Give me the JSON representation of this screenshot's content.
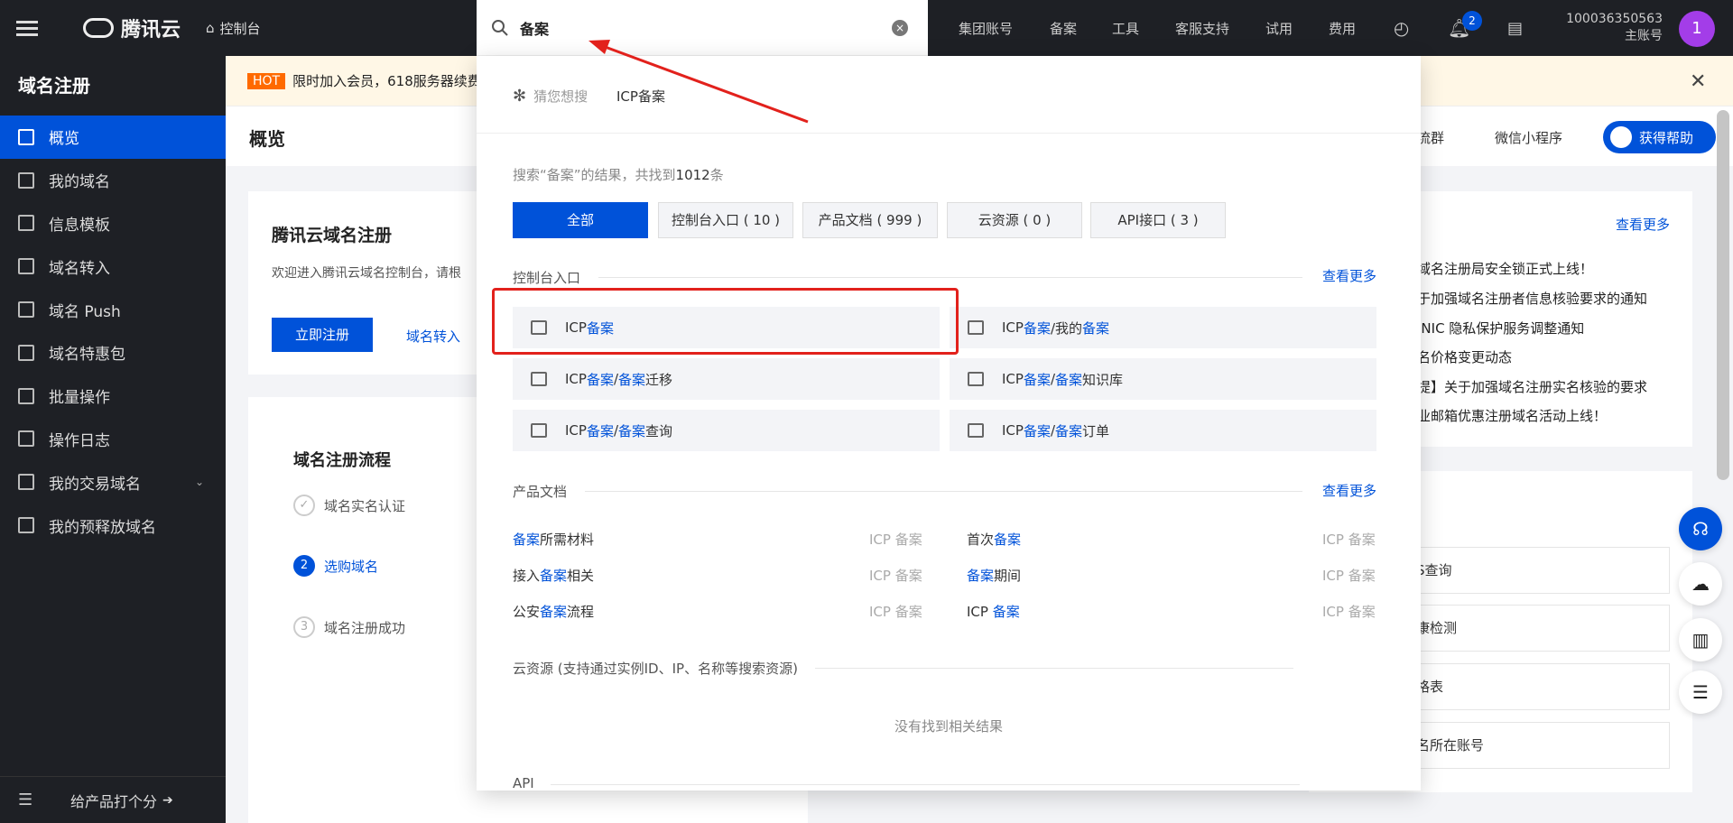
{
  "topbar": {
    "brand": "腾讯云",
    "console": "控制台",
    "search_value": "备案",
    "nav": [
      "集团账号",
      "备案",
      "工具",
      "客服支持",
      "试用",
      "费用"
    ],
    "notification_count": "2",
    "account_id": "100036350563",
    "account_role": "主账号",
    "avatar_letter": "1"
  },
  "sidebar": {
    "title": "域名注册",
    "items": [
      {
        "label": "概览",
        "icon": "grid-icon",
        "active": true
      },
      {
        "label": "我的域名",
        "icon": "domain-icon"
      },
      {
        "label": "信息模板",
        "icon": "template-icon"
      },
      {
        "label": "域名转入",
        "icon": "transfer-icon"
      },
      {
        "label": "域名 Push",
        "icon": "push-icon"
      },
      {
        "label": "域名特惠包",
        "icon": "package-icon"
      },
      {
        "label": "批量操作",
        "icon": "batch-icon"
      },
      {
        "label": "操作日志",
        "icon": "log-icon"
      },
      {
        "label": "我的交易域名",
        "icon": "trade-icon",
        "expandable": true
      },
      {
        "label": "我的预释放域名",
        "icon": "release-icon"
      }
    ],
    "footer": "给产品打个分"
  },
  "banner": {
    "tag": "HOT",
    "text": "限时加入会员，618服务器续费2"
  },
  "page": {
    "title": "概览",
    "links": [
      "流群",
      "微信小程序"
    ],
    "help_button": "获得帮助"
  },
  "welcome_card": {
    "title": "腾讯云域名注册",
    "desc": "欢迎进入腾讯云域名控制台，请根",
    "register_button": "立即注册",
    "transfer_link": "域名转入"
  },
  "flow_card": {
    "title": "域名注册流程",
    "steps": [
      {
        "num": "✓",
        "label": "域名实名认证"
      },
      {
        "num": "2",
        "label": "选购域名",
        "current": true
      },
      {
        "num": "3",
        "label": "域名注册成功"
      }
    ]
  },
  "news": {
    "more": "查看更多",
    "items": [
      "域名注册局安全锁正式上线！",
      "于加强域名注册者信息核验要求的通知",
      "INIC 隐私保护服务调整通知",
      "名价格变更动态",
      "提】关于加强域名注册实名核验的要求",
      "业邮箱优惠注册域名活动上线！"
    ]
  },
  "tools": [
    "S查询",
    "康检测",
    "格表",
    "名所在账号"
  ],
  "dropdown": {
    "guess_label": "猜您想搜",
    "guess_query": "ICP备案",
    "summary_prefix": "搜索“备案”的结果，共找到",
    "summary_count": "1012",
    "summary_suffix": "条",
    "filters": [
      {
        "label": "全部",
        "active": true
      },
      {
        "label": "控制台入口 ( 10 )"
      },
      {
        "label": "产品文档 ( 999 )"
      },
      {
        "label": "云资源 ( 0 )"
      },
      {
        "label": "API接口 ( 3 )"
      }
    ],
    "console_section": "控制台入口",
    "console_more": "查看更多",
    "console_entries": [
      {
        "pre": "ICP",
        "hl": "备案",
        "post": "",
        "icon": "icp-icon"
      },
      {
        "pre": "ICP",
        "hl": "备案",
        "post": "/我的",
        "hl2": "备案",
        "icon": "bookmark-icon"
      },
      {
        "pre": "ICP",
        "hl": "备案",
        "post": "/",
        "hl2": "备案",
        "post2": "迁移",
        "icon": "migrate-icon"
      },
      {
        "pre": "ICP",
        "hl": "备案",
        "post": "/",
        "hl2": "备案",
        "post2": "知识库",
        "icon": "knowledge-icon"
      },
      {
        "pre": "ICP",
        "hl": "备案",
        "post": "/",
        "hl2": "备案",
        "post2": "查询",
        "icon": "query-icon"
      },
      {
        "pre": "ICP",
        "hl": "备案",
        "post": "/",
        "hl2": "备案",
        "post2": "订单",
        "icon": "order-icon"
      }
    ],
    "docs_section": "产品文档",
    "docs_more": "查看更多",
    "docs": [
      {
        "pre": "",
        "hl": "备案",
        "post": "所需材料",
        "tag": "ICP 备案"
      },
      {
        "pre": "首次",
        "hl": "备案",
        "post": "",
        "tag": "ICP 备案"
      },
      {
        "pre": "接入",
        "hl": "备案",
        "post": "相关",
        "tag": "ICP 备案"
      },
      {
        "pre": "",
        "hl": "备案",
        "post": "期间",
        "tag": "ICP 备案"
      },
      {
        "pre": "公安",
        "hl": "备案",
        "post": "流程",
        "tag": "ICP 备案"
      },
      {
        "pre": "ICP ",
        "hl": "备案",
        "post": "",
        "tag": "ICP 备案"
      }
    ],
    "cloud_section": "云资源 (支持通过实例ID、IP、名称等搜索资源)",
    "cloud_empty": "没有找到相关结果",
    "api_section": "API"
  }
}
